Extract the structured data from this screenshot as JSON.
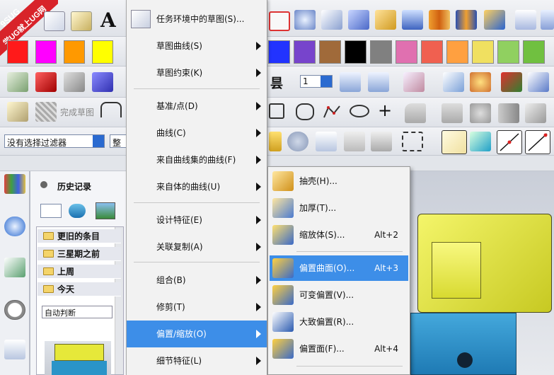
{
  "watermark": {
    "line1": "9SUG",
    "line2": "学UG就上UG网"
  },
  "toolbar": {
    "text_icon": "A",
    "finish_sketch_label": "完成草图",
    "filter_select": "没有选择过滤器",
    "filter_select2": "整",
    "layer_value": "1",
    "btn_partial": "昙"
  },
  "colors": {
    "swatches_left": [
      "#ff1a1a",
      "#ff00ff",
      "#ff9900",
      "#ffff00"
    ],
    "swatches_right": [
      "#2233ff",
      "#7744cc",
      "#a06a3a",
      "#000000",
      "#808080",
      "#e070b0",
      "#f06050",
      "#ffa040",
      "#f0e060",
      "#90d060",
      "#70c040"
    ],
    "accent": "#3d8ee8"
  },
  "history": {
    "title": "历史记录",
    "items": [
      "更旧的条目",
      "三星期之前",
      "上周",
      "今天"
    ],
    "auto_label": "自动判断"
  },
  "menu": {
    "items": [
      {
        "label": "任务环境中的草图(S)...",
        "has_sub": false
      },
      {
        "label": "草图曲线(S)",
        "has_sub": true
      },
      {
        "label": "草图约束(K)",
        "has_sub": true
      },
      {
        "label": "基准/点(D)",
        "has_sub": true
      },
      {
        "label": "曲线(C)",
        "has_sub": true
      },
      {
        "label": "来自曲线集的曲线(F)",
        "has_sub": true
      },
      {
        "label": "来自体的曲线(U)",
        "has_sub": true
      },
      {
        "label": "设计特征(E)",
        "has_sub": true
      },
      {
        "label": "关联复制(A)",
        "has_sub": true
      },
      {
        "label": "组合(B)",
        "has_sub": true
      },
      {
        "label": "修剪(T)",
        "has_sub": true
      },
      {
        "label": "偏置/缩放(O)",
        "has_sub": true
      },
      {
        "label": "细节特征(L)",
        "has_sub": true
      }
    ]
  },
  "submenu": {
    "items": [
      {
        "label": "抽壳(H)...",
        "shortcut": ""
      },
      {
        "label": "加厚(T)...",
        "shortcut": ""
      },
      {
        "label": "缩放体(S)...",
        "shortcut": "Alt+2"
      },
      {
        "label": "偏置曲面(O)...",
        "shortcut": "Alt+3"
      },
      {
        "label": "可变偏置(V)...",
        "shortcut": ""
      },
      {
        "label": "大致偏置(R)...",
        "shortcut": ""
      },
      {
        "label": "偏置面(F)...",
        "shortcut": "Alt+4"
      }
    ]
  },
  "icons": [
    "sketch-icon",
    "folder-icon",
    "history-clock-icon",
    "info-icon",
    "shell-icon",
    "thicken-icon",
    "scale-body-icon",
    "offset-surface-icon",
    "variable-offset-icon",
    "rough-offset-icon",
    "offset-face-icon"
  ]
}
